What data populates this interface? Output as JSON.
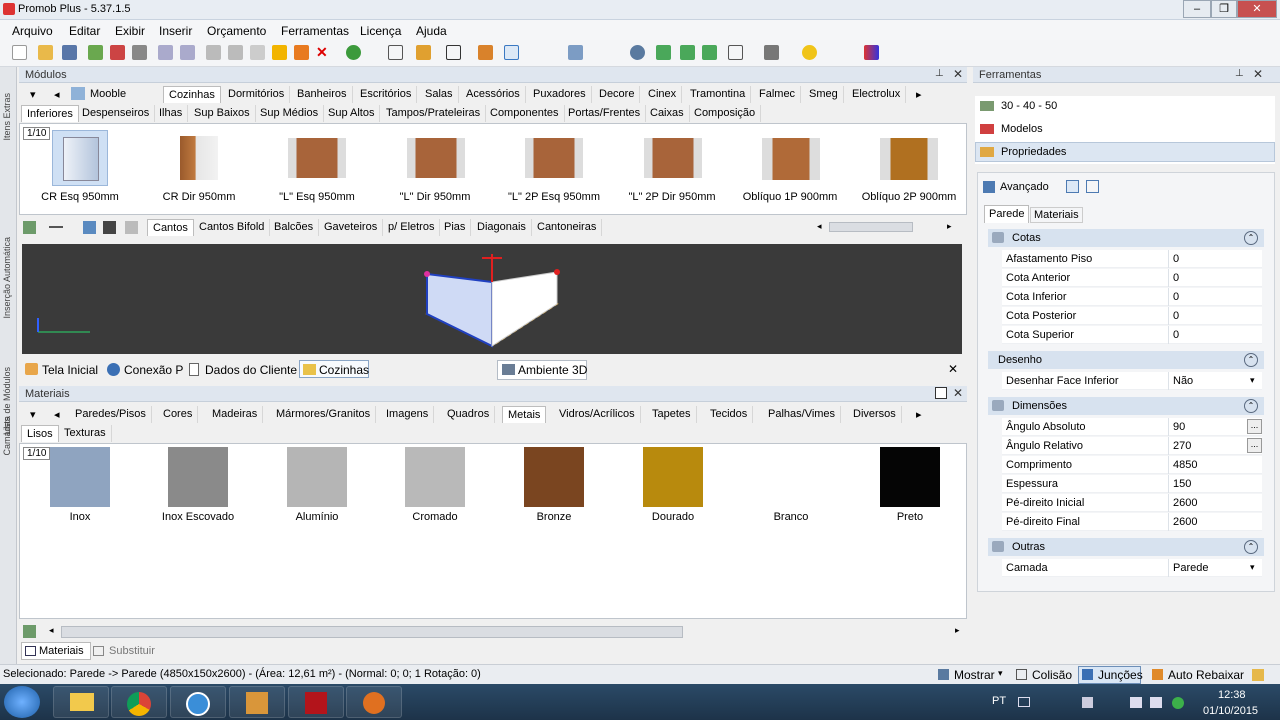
{
  "window": {
    "title": "Promob Plus - 5.37.1.5"
  },
  "menu": [
    "Arquivo",
    "Editar",
    "Exibir",
    "Inserir",
    "Orçamento",
    "Ferramentas",
    "Licença",
    "Ajuda"
  ],
  "left_strip": [
    "Itens Extras",
    "Inserção Automática",
    "Lista de Módulos",
    "Camadas"
  ],
  "modules": {
    "header": "Módulos",
    "brand": "Mooble",
    "tabs1": [
      "Cozinhas",
      "Dormitórios",
      "Banheiros",
      "Escritórios",
      "Salas",
      "Acessórios",
      "Puxadores",
      "Decore",
      "Cinex",
      "Tramontina",
      "Falmec",
      "Smeg",
      "Electrolux"
    ],
    "tabs2": [
      "Inferiores",
      "Despenseiros",
      "Ilhas",
      "Sup Baixos",
      "Sup Médios",
      "Sup Altos",
      "Tampos/Prateleiras",
      "Componentes",
      "Portas/Frentes",
      "Caixas",
      "Composição"
    ],
    "page": "1/10",
    "items": [
      "CR Esq 950mm",
      "CR Dir 950mm",
      "\"L\" Esq 950mm",
      "\"L\" Dir 950mm",
      "\"L\" 2P Esq 950mm",
      "\"L\" 2P Dir 950mm",
      "Oblíquo 1P 900mm",
      "Oblíquo 2P 900mm"
    ],
    "subtabs": [
      "Cantos",
      "Cantos Bifold",
      "Balcões",
      "Gaveteiros",
      "p/ Eletros",
      "Pias",
      "Diagonais",
      "Cantoneiras"
    ]
  },
  "doc_tabs": [
    "Tela Inicial",
    "Conexão P",
    "Dados do Cliente",
    "Cozinhas"
  ],
  "viewport_tab": "Ambiente 3D",
  "materials": {
    "header": "Materiais",
    "tabs1": [
      "Paredes/Pisos",
      "Cores",
      "Madeiras",
      "Mármores/Granitos",
      "Imagens",
      "Quadros",
      "Metais",
      "Vidros/Acrílicos",
      "Tapetes",
      "Tecidos",
      "Palhas/Vimes",
      "Diversos"
    ],
    "tabs2": [
      "Lisos",
      "Texturas"
    ],
    "page": "1/10",
    "swatches": [
      {
        "name": "Inox",
        "color": "#8fa4c0"
      },
      {
        "name": "Inox Escovado",
        "color": "#8a8a8a"
      },
      {
        "name": "Alumínio",
        "color": "#b5b5b5"
      },
      {
        "name": "Cromado",
        "color": "#b9b9b9"
      },
      {
        "name": "Bronze",
        "color": "#7a4520"
      },
      {
        "name": "Dourado",
        "color": "#b88a0d"
      },
      {
        "name": "Branco",
        "color": "#ffffff"
      },
      {
        "name": "Preto",
        "color": "#050505"
      }
    ],
    "bottom_tabs": [
      "Materiais",
      "Substituir"
    ]
  },
  "tools": {
    "header": "Ferramentas",
    "items": [
      "30 - 40 - 50",
      "Modelos",
      "Propriedades"
    ],
    "advanced": "Avançado",
    "tabs": [
      "Parede",
      "Materiais"
    ],
    "groups": [
      {
        "name": "Cotas",
        "rows": [
          [
            "Afastamento Piso",
            "0"
          ],
          [
            "Cota Anterior",
            "0"
          ],
          [
            "Cota Inferior",
            "0"
          ],
          [
            "Cota Posterior",
            "0"
          ],
          [
            "Cota Superior",
            "0"
          ]
        ]
      },
      {
        "name": "Desenho",
        "rows": [
          [
            "Desenhar Face Inferior",
            "Não"
          ]
        ]
      },
      {
        "name": "Dimensões",
        "rows": [
          [
            "Ângulo Absoluto",
            "90"
          ],
          [
            "Ângulo Relativo",
            "270"
          ],
          [
            "Comprimento",
            "4850"
          ],
          [
            "Espessura",
            "150"
          ],
          [
            "Pé-direito Inicial",
            "2600"
          ],
          [
            "Pé-direito Final",
            "2600"
          ]
        ]
      },
      {
        "name": "Outras",
        "rows": [
          [
            "Camada",
            "Parede"
          ]
        ]
      }
    ]
  },
  "status": {
    "text": "Selecionado: Parede -> Parede (4850x150x2600) - (Área: 12,61 m²) - (Normal: 0; 0; 1 Rotação: 0)",
    "buttons": [
      "Mostrar",
      "Colisão",
      "Junções",
      "Auto Rebaixar"
    ]
  },
  "taskbar": {
    "lang": "PT",
    "time": "12:38",
    "date": "01/10/2015"
  },
  "colors": {
    "accent": "#3a78c2",
    "viewport_bg": "#3a3a3a",
    "group_bg": "#d7e2ef"
  }
}
